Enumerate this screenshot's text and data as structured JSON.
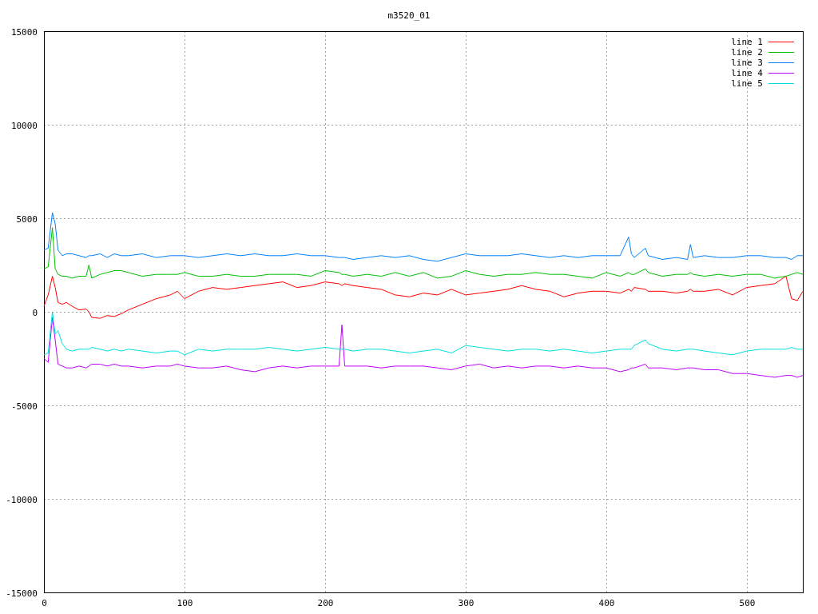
{
  "plot": {
    "chart_data": {
      "type": "line",
      "title": "m3520_01",
      "x": [
        0,
        3,
        6,
        8,
        10,
        13,
        16,
        20,
        25,
        30,
        32,
        34,
        40,
        45,
        50,
        55,
        60,
        70,
        80,
        90,
        95,
        100,
        110,
        120,
        130,
        140,
        150,
        160,
        170,
        180,
        190,
        200,
        210,
        212,
        214,
        220,
        230,
        240,
        250,
        260,
        270,
        280,
        290,
        300,
        310,
        320,
        330,
        340,
        350,
        360,
        370,
        380,
        390,
        400,
        410,
        416,
        418,
        420,
        428,
        430,
        440,
        450,
        458,
        460,
        462,
        470,
        480,
        490,
        500,
        510,
        520,
        528,
        532,
        536,
        540
      ],
      "series": [
        {
          "name": "line 1",
          "color": "#ff0000",
          "values": [
            300,
            900,
            1900,
            1300,
            500,
            400,
            500,
            300,
            100,
            150,
            0,
            -300,
            -350,
            -200,
            -250,
            -100,
            100,
            400,
            700,
            900,
            1100,
            700,
            1100,
            1300,
            1200,
            1300,
            1400,
            1500,
            1600,
            1300,
            1400,
            1600,
            1500,
            1400,
            1500,
            1400,
            1300,
            1200,
            900,
            800,
            1000,
            900,
            1200,
            900,
            1000,
            1100,
            1200,
            1400,
            1200,
            1100,
            800,
            1000,
            1100,
            1100,
            1000,
            1200,
            1100,
            1300,
            1200,
            1100,
            1100,
            1000,
            1100,
            1200,
            1100,
            1100,
            1200,
            900,
            1300,
            1400,
            1500,
            1900,
            700,
            600,
            1100
          ]
        },
        {
          "name": "line 2",
          "color": "#00c000",
          "values": [
            2300,
            2400,
            4500,
            2300,
            2000,
            1900,
            1900,
            1800,
            1900,
            1900,
            2500,
            1800,
            2000,
            2100,
            2200,
            2200,
            2100,
            1900,
            2000,
            2000,
            2000,
            2100,
            1900,
            1900,
            2000,
            1900,
            1900,
            2000,
            2000,
            2000,
            1900,
            2200,
            2100,
            2000,
            2000,
            1900,
            2000,
            1900,
            2100,
            1900,
            2100,
            1800,
            1900,
            2200,
            2000,
            1900,
            2000,
            2000,
            2100,
            2000,
            2000,
            1900,
            1800,
            2100,
            1900,
            2100,
            2000,
            2000,
            2300,
            2100,
            1900,
            2000,
            2000,
            2100,
            2000,
            1900,
            2000,
            1900,
            2000,
            2000,
            1800,
            1900,
            2000,
            2100,
            2000
          ]
        },
        {
          "name": "line 3",
          "color": "#0080ff",
          "values": [
            3300,
            3400,
            5300,
            4700,
            3300,
            3000,
            3100,
            3100,
            3000,
            2900,
            3000,
            3000,
            3100,
            2900,
            3100,
            3000,
            3000,
            3100,
            2900,
            3000,
            3000,
            3000,
            2900,
            3000,
            3100,
            3000,
            3100,
            3000,
            3000,
            3100,
            3000,
            3000,
            2900,
            2900,
            2900,
            2800,
            2900,
            3000,
            2900,
            3000,
            2800,
            2700,
            2900,
            3100,
            3000,
            3000,
            3000,
            3100,
            3000,
            2900,
            3000,
            2900,
            3000,
            3000,
            3000,
            4000,
            3100,
            2900,
            3400,
            3000,
            2800,
            2900,
            2800,
            3600,
            2900,
            3000,
            2900,
            2900,
            3000,
            3000,
            2900,
            2900,
            2800,
            3000,
            3000
          ]
        },
        {
          "name": "line 4",
          "color": "#c000ff",
          "values": [
            -2500,
            -2700,
            -300,
            -1500,
            -2800,
            -2900,
            -3000,
            -3000,
            -2900,
            -3000,
            -2900,
            -2800,
            -2800,
            -2900,
            -2800,
            -2900,
            -2900,
            -3000,
            -2900,
            -2900,
            -2800,
            -2900,
            -3000,
            -3000,
            -2900,
            -3100,
            -3200,
            -3000,
            -2900,
            -3000,
            -2900,
            -2900,
            -2900,
            -700,
            -2900,
            -2900,
            -2900,
            -3000,
            -2900,
            -2900,
            -2900,
            -3000,
            -3100,
            -2900,
            -2800,
            -3000,
            -2900,
            -3000,
            -2900,
            -2900,
            -3000,
            -2900,
            -3000,
            -3000,
            -3200,
            -3100,
            -3000,
            -3000,
            -2800,
            -3000,
            -3000,
            -3100,
            -3000,
            -3000,
            -3000,
            -3100,
            -3100,
            -3300,
            -3300,
            -3400,
            -3500,
            -3400,
            -3400,
            -3500,
            -3400
          ]
        },
        {
          "name": "line 5",
          "color": "#00e0e0",
          "values": [
            -2300,
            -2200,
            0,
            -1200,
            -1000,
            -1700,
            -2000,
            -2100,
            -2000,
            -2000,
            -2000,
            -1900,
            -2000,
            -2100,
            -2000,
            -2100,
            -2000,
            -2100,
            -2200,
            -2100,
            -2100,
            -2300,
            -2000,
            -2100,
            -2000,
            -2000,
            -2000,
            -1900,
            -2000,
            -2100,
            -2000,
            -1900,
            -2000,
            -2000,
            -2000,
            -2100,
            -2000,
            -2000,
            -2100,
            -2200,
            -2100,
            -2000,
            -2200,
            -1800,
            -1900,
            -2000,
            -2100,
            -2000,
            -2000,
            -2100,
            -2000,
            -2100,
            -2200,
            -2100,
            -2000,
            -2000,
            -2000,
            -1800,
            -1500,
            -1700,
            -2000,
            -2100,
            -2000,
            -2000,
            -2000,
            -2100,
            -2200,
            -2300,
            -2100,
            -2000,
            -2000,
            -2000,
            -1900,
            -2000,
            -2000
          ]
        }
      ],
      "grid": true,
      "legend": true,
      "xlim": [
        0,
        540
      ],
      "ylim": [
        -15000,
        15000
      ],
      "xticks": [
        0,
        100,
        200,
        300,
        400,
        500
      ],
      "yticks": [
        -15000,
        -10000,
        -5000,
        0,
        5000,
        10000,
        15000
      ]
    }
  }
}
